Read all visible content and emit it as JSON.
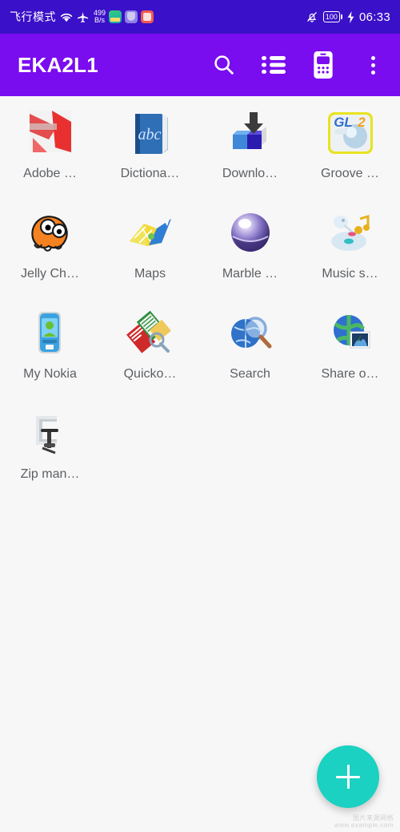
{
  "colors": {
    "status_bar_bg": "#3a10c8",
    "app_bar_bg": "#7a0cf0",
    "page_bg": "#f7f7f8",
    "fab_bg": "#1bd1c1",
    "label_text": "#5d6063"
  },
  "status_bar": {
    "mode_label": "飞行模式",
    "wifi_icon": "wifi-icon",
    "airplane_icon": "airplane-icon",
    "net_speed_value": "499",
    "net_speed_unit": "B/s",
    "tray_icons": [
      "app-icon-green",
      "app-icon-shield",
      "app-icon-red"
    ],
    "mute_icon": "bell-muted-icon",
    "battery_level": "100",
    "charging_icon": "charging-bolt-icon",
    "time": "06:33"
  },
  "app_bar": {
    "title": "EKA2L1",
    "actions": [
      {
        "name": "search-icon",
        "label": "Search"
      },
      {
        "name": "list-icon",
        "label": "List view"
      },
      {
        "name": "device-icon",
        "label": "Devices"
      },
      {
        "name": "overflow-menu-icon",
        "label": "More options"
      }
    ]
  },
  "apps": [
    {
      "label": "Adobe …",
      "icon": "adobe-reader-icon"
    },
    {
      "label": "Dictiona…",
      "icon": "dictionary-icon"
    },
    {
      "label": "Downlo…",
      "icon": "download-icon"
    },
    {
      "label": "Groove …",
      "icon": "groove-gl2-icon"
    },
    {
      "label": "Jelly Ch…",
      "icon": "jelly-character-icon"
    },
    {
      "label": "Maps",
      "icon": "maps-icon"
    },
    {
      "label": "Marble …",
      "icon": "marble-sphere-icon"
    },
    {
      "label": "Music s…",
      "icon": "music-cd-icon"
    },
    {
      "label": "My Nokia",
      "icon": "my-nokia-phone-icon"
    },
    {
      "label": "Quicko…",
      "icon": "quickoffice-icon"
    },
    {
      "label": "Search",
      "icon": "search-globe-icon"
    },
    {
      "label": "Share o…",
      "icon": "share-online-icon"
    },
    {
      "label": "Zip man…",
      "icon": "zip-clamp-icon"
    }
  ],
  "fab": {
    "icon": "plus-icon",
    "label": "Add"
  },
  "watermark": {
    "line1": "图片来源网络",
    "line2": "www.example.com"
  }
}
